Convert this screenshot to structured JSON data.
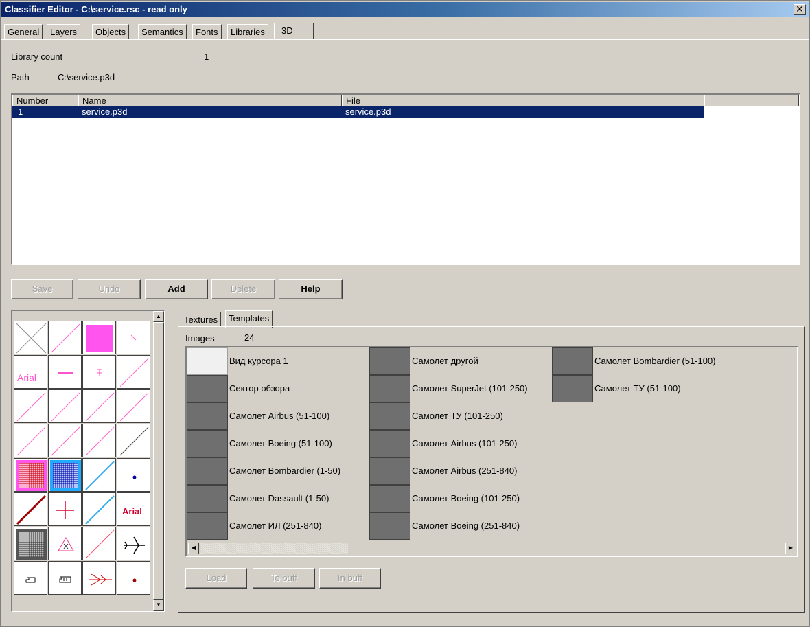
{
  "window": {
    "title": "Classifier Editor - C:\\service.rsc - read only",
    "close": "✕"
  },
  "tabs": [
    {
      "label": "General"
    },
    {
      "label": "Layers"
    },
    {
      "label": "Objects"
    },
    {
      "label": "Semantics"
    },
    {
      "label": "Fonts"
    },
    {
      "label": "Libraries"
    },
    {
      "label": "3D"
    }
  ],
  "info": {
    "library_count_label": "Library count",
    "library_count_value": "1",
    "path_label": "Path",
    "path_value": "C:\\service.p3d"
  },
  "library_list": {
    "columns": [
      "Number",
      "Name",
      "File"
    ],
    "rows": [
      {
        "number": "1",
        "name": "service.p3d",
        "file": "service.p3d"
      }
    ]
  },
  "buttons": {
    "save": "Save",
    "undo": "Undo",
    "add": "Add",
    "delete": "Delete",
    "help": "Help"
  },
  "palette": {
    "arial": "Arial",
    "arial_bold": "Arial"
  },
  "subtabs": {
    "textures": "Textures",
    "templates": "Templates"
  },
  "images": {
    "label": "Images",
    "count": "24",
    "items": [
      "Вид курсора 1",
      "Сектор обзора",
      "Самолет Airbus (51-100)",
      "Самолет Boeing (51-100)",
      "Самолет Bombardier (1-50)",
      "Самолет Dassault (1-50)",
      "Самолет ИЛ (251-840)",
      "Самолет другой",
      "Самолет SuperJet (101-250)",
      "Самолет ТУ (101-250)",
      "Самолет Airbus (101-250)",
      "Самолет Airbus (251-840)",
      "Самолет Boeing (101-250)",
      "Самолет Boeing (251-840)",
      "Самолет Bombardier (51-100)",
      "Самолет ТУ (51-100)"
    ]
  },
  "bottom_buttons": {
    "load": "Load",
    "to_buff": "To buff",
    "in_buff": "In buff"
  },
  "icons": {
    "scroll_up": "▲",
    "scroll_down": "▼",
    "scroll_left": "◀",
    "scroll_right": "▶"
  }
}
